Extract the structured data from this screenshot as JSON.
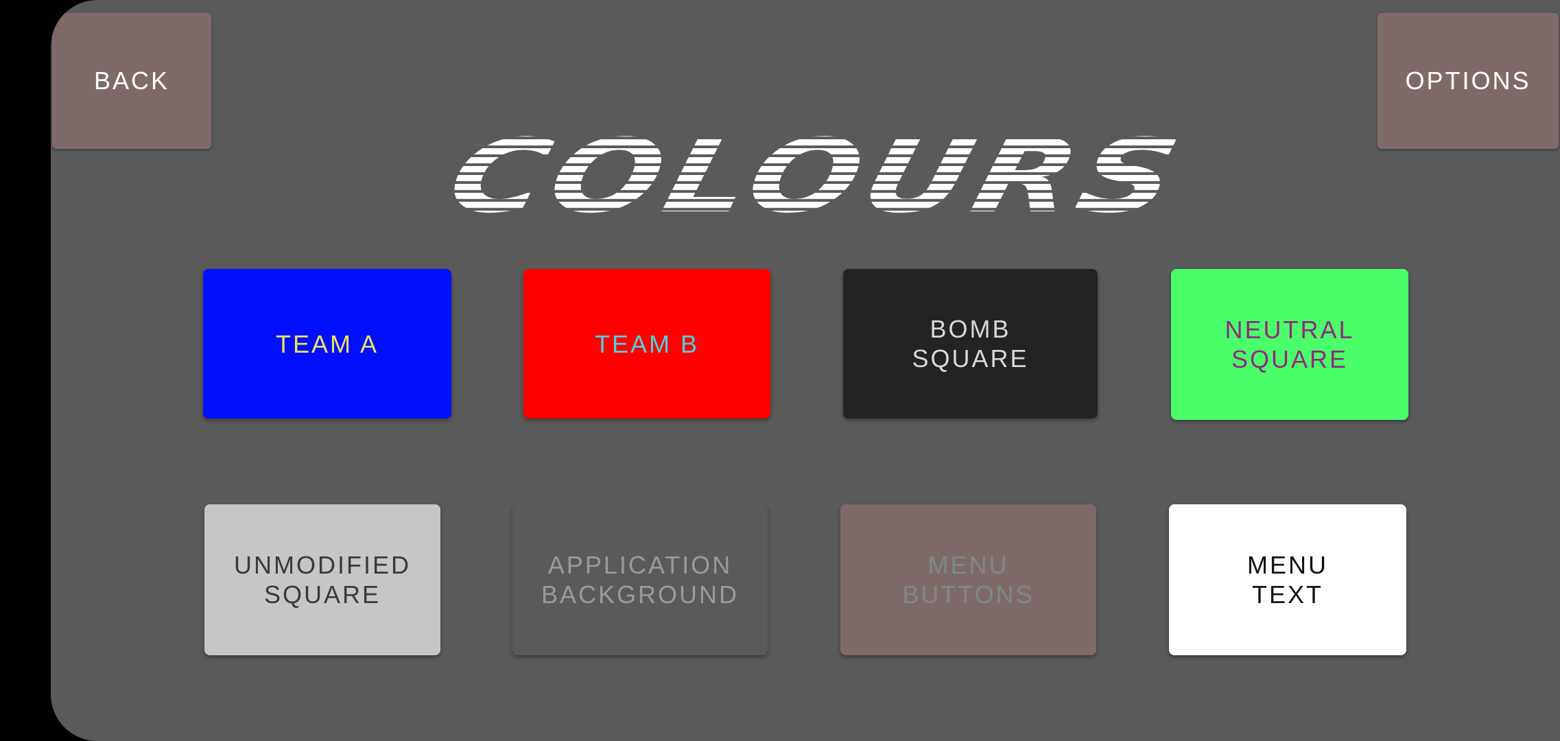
{
  "nav": {
    "back_label": "BACK",
    "options_label": "OPTIONS"
  },
  "title": "COLOURS",
  "swatches": [
    {
      "id": "team-a",
      "label": "TEAM A",
      "bg": "#0010ff",
      "fg": "#f1e35a"
    },
    {
      "id": "team-b",
      "label": "TEAM B",
      "bg": "#ff0000",
      "fg": "#4fd0dc"
    },
    {
      "id": "bomb-square",
      "label": "BOMB\nSQUARE",
      "bg": "#232323",
      "fg": "#d8d8d8"
    },
    {
      "id": "neutral-square",
      "label": "NEUTRAL\nSQUARE",
      "bg": "#4bff6b",
      "fg": "#8e2a7e"
    },
    {
      "id": "unmodified-square",
      "label": "UNMODIFIED\nSQUARE",
      "bg": "#c6c6c6",
      "fg": "#3a3a3a"
    },
    {
      "id": "application-background",
      "label": "APPLICATION\nBACKGROUND",
      "bg": "#5a5a5a",
      "fg": "#9a9a9a"
    },
    {
      "id": "menu-buttons",
      "label": "MENU\nBUTTONS",
      "bg": "#7f6a6a",
      "fg": "#7f8a8a"
    },
    {
      "id": "menu-text",
      "label": "MENU\nTEXT",
      "bg": "#ffffff",
      "fg": "#111111"
    }
  ]
}
